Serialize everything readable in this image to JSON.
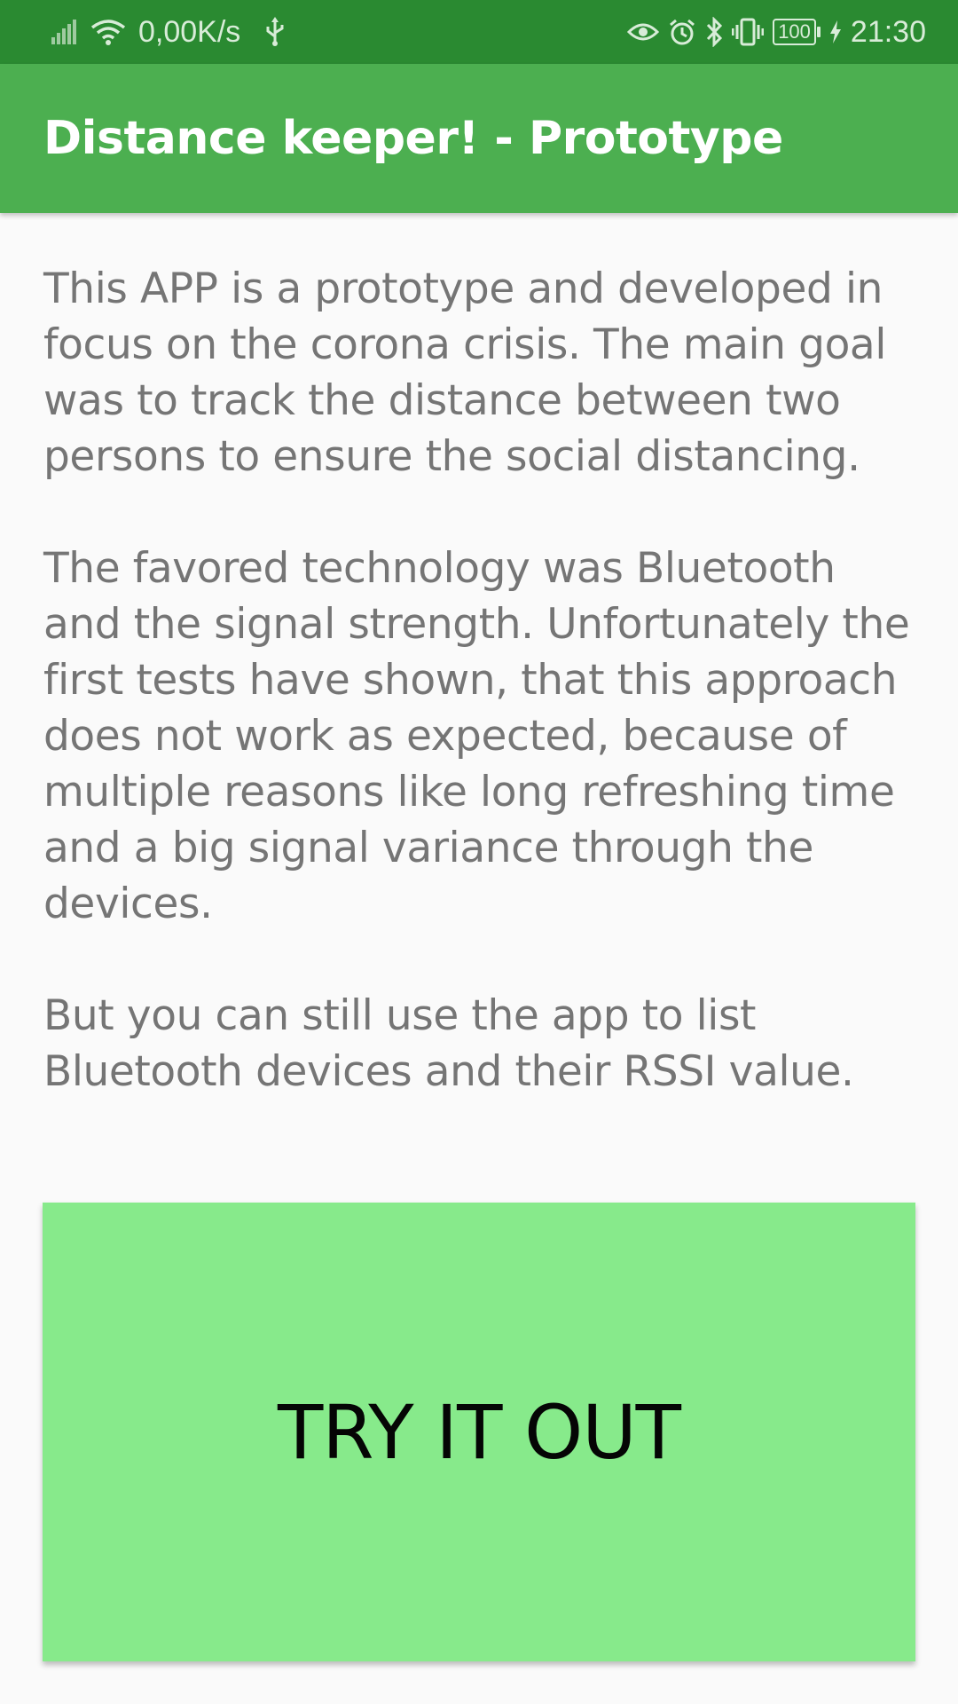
{
  "status_bar": {
    "network_speed": "0,00K/s",
    "battery_level": "100",
    "time": "21:30",
    "icons_left": [
      "signal-icon",
      "wifi-icon",
      "usb-icon"
    ],
    "icons_right": [
      "eye-icon",
      "alarm-icon",
      "bluetooth-icon",
      "vibrate-icon",
      "battery-icon",
      "charging-icon"
    ]
  },
  "app_bar": {
    "title": "Distance keeper! - Prototype"
  },
  "main": {
    "paragraphs": [
      "This APP is a prototype and developed in focus on the corona crisis. The main goal was to track the distance between two persons to ensure the social distancing.",
      "The favored technology was Bluetooth and the signal strength. Unfortunately the first tests have shown, that this approach does not work as expected, because of multiple reasons like long refreshing time and a big signal variance through the devices.",
      "But you can still use the app to list Bluetooth devices and their RSSI value."
    ],
    "try_button_label": "TRY IT OUT"
  },
  "colors": {
    "status_bar": "#2a8a31",
    "app_bar": "#4caf50",
    "button": "#87ea8b",
    "body_text": "#757575",
    "background": "#fafafa"
  }
}
